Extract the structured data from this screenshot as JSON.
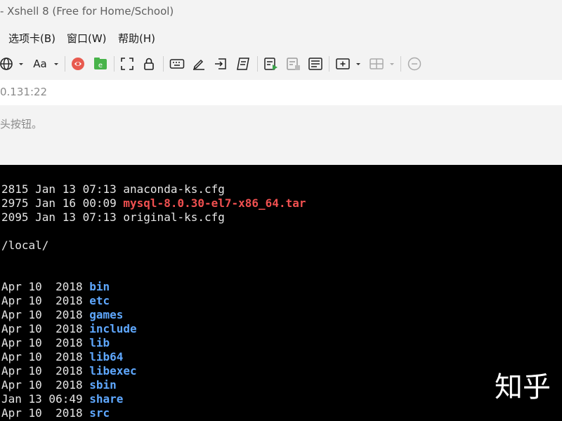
{
  "window": {
    "title": "- Xshell 8 (Free for Home/School)"
  },
  "menu": {
    "items": [
      "选项卡(B)",
      "窗口(W)",
      "帮助(H)"
    ]
  },
  "toolbar": {
    "font_button_label": "Aa"
  },
  "address_bar": {
    "text": "0.131:22"
  },
  "hint": {
    "text": "头按钮。"
  },
  "terminal": {
    "lines": [
      {
        "prefix": "2815 Jan 13 07:13 ",
        "name": "anaconda-ks.cfg",
        "style": "plain"
      },
      {
        "prefix": "2975 Jan 16 00:09 ",
        "name": "mysql-8.0.30-el7-x86_64.tar",
        "style": "red"
      },
      {
        "prefix": "2095 Jan 13 07:13 ",
        "name": "original-ks.cfg",
        "style": "plain"
      },
      {
        "prefix": "",
        "name": "",
        "style": "plain"
      },
      {
        "prefix": "/local/",
        "name": "",
        "style": "plain"
      },
      {
        "prefix": "",
        "name": "",
        "style": "plain"
      },
      {
        "prefix": "",
        "name": "",
        "style": "plain"
      },
      {
        "prefix": "Apr 10  2018 ",
        "name": "bin",
        "style": "blue"
      },
      {
        "prefix": "Apr 10  2018 ",
        "name": "etc",
        "style": "blue"
      },
      {
        "prefix": "Apr 10  2018 ",
        "name": "games",
        "style": "blue"
      },
      {
        "prefix": "Apr 10  2018 ",
        "name": "include",
        "style": "blue"
      },
      {
        "prefix": "Apr 10  2018 ",
        "name": "lib",
        "style": "blue"
      },
      {
        "prefix": "Apr 10  2018 ",
        "name": "lib64",
        "style": "blue"
      },
      {
        "prefix": "Apr 10  2018 ",
        "name": "libexec",
        "style": "blue"
      },
      {
        "prefix": "Apr 10  2018 ",
        "name": "sbin",
        "style": "blue"
      },
      {
        "prefix": "Jan 13 06:49 ",
        "name": "share",
        "style": "blue"
      },
      {
        "prefix": "Apr 10  2018 ",
        "name": "src",
        "style": "blue"
      }
    ]
  },
  "watermark": {
    "text": "知乎"
  },
  "icons": [
    "globe-icon",
    "font-icon",
    "xshell-icon",
    "xftp-icon",
    "fullscreen-icon",
    "lock-icon",
    "keyboard-icon",
    "compose-icon",
    "transfer-icon",
    "script-icon",
    "log-start-icon",
    "log-stop-icon",
    "log-icon",
    "new-tab-icon",
    "layout-icon",
    "chat-icon"
  ],
  "colors": {
    "terminal_bg": "#000000",
    "terminal_fg": "#e6e6e6",
    "archive": "#f05050",
    "directory": "#5fa8ff"
  }
}
